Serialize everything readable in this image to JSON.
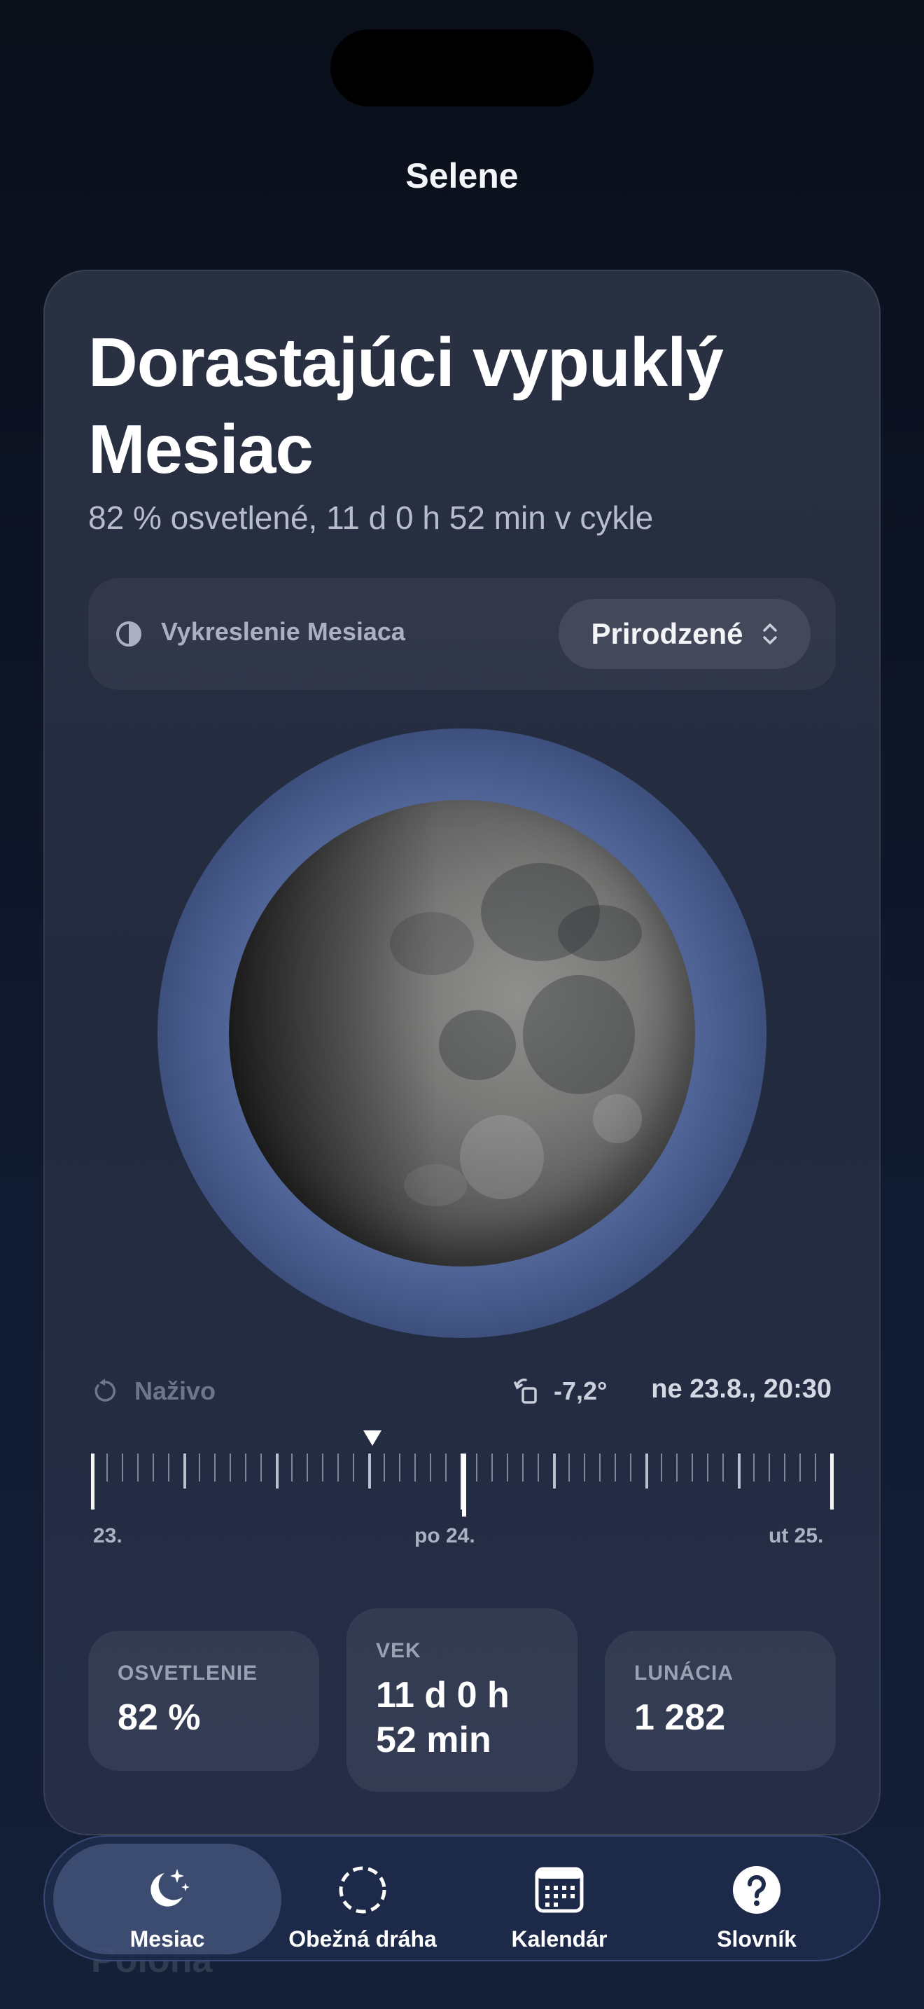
{
  "app": {
    "title": "Selene"
  },
  "phase": {
    "title": "Dorastajúci vypuklý Mesiac",
    "subtitle": "82 % osvetlené, 11 d 0 h 52 min v cykle"
  },
  "render": {
    "label": "Vykreslenie Mesiaca",
    "value": "Prirodzené"
  },
  "controls": {
    "live_label": "Naživo",
    "angle": "-7,2°",
    "datetime": "ne 23.8., 20:30"
  },
  "timeline": {
    "labels": [
      "23.",
      "po 24.",
      "ut 25."
    ]
  },
  "stats": [
    {
      "label": "OSVETLENIE",
      "value": "82 %"
    },
    {
      "label": "VEK",
      "value": "11 d 0 h 52 min"
    },
    {
      "label": "LUNÁCIA",
      "value": "1 282"
    }
  ],
  "tabs": [
    {
      "label": "Mesiac",
      "icon": "moon-stars-icon",
      "active": true
    },
    {
      "label": "Obežná dráha",
      "icon": "orbit-icon",
      "active": false
    },
    {
      "label": "Kalendár",
      "icon": "calendar-icon",
      "active": false
    },
    {
      "label": "Slovník",
      "icon": "question-icon",
      "active": false
    }
  ],
  "behind_tabbar_text": "Poloha",
  "colors": {
    "accent": "#4f6396",
    "background": "#0d1424"
  }
}
